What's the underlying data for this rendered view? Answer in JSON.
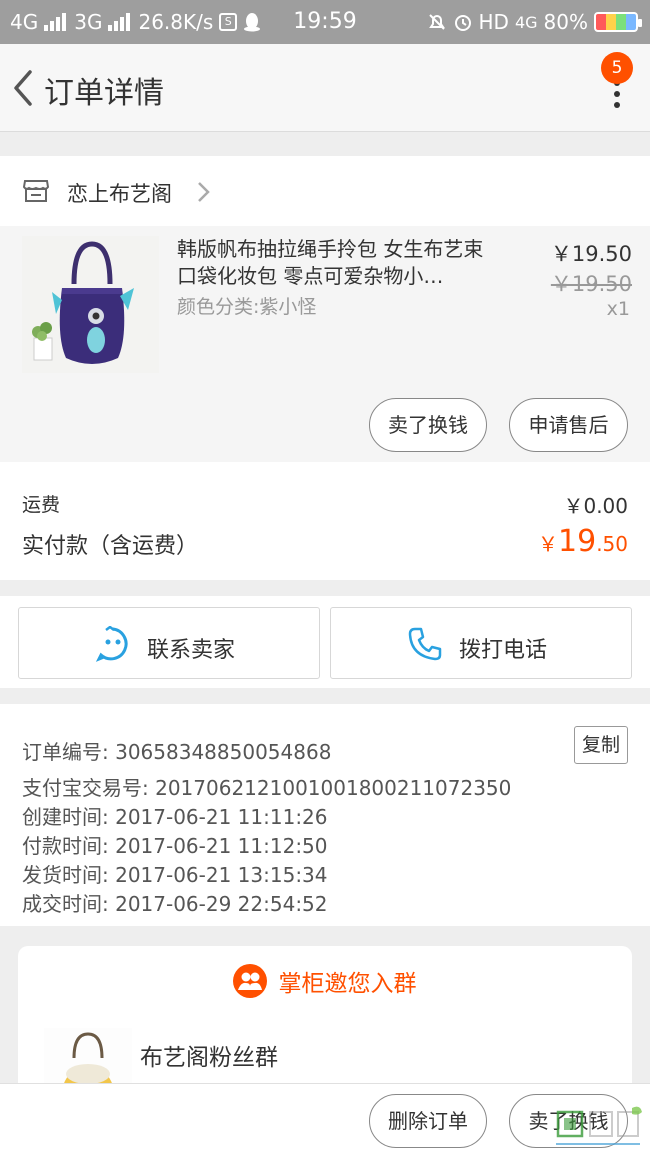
{
  "status_bar": {
    "net1": "4G",
    "net2": "3G",
    "speed": "26.8K/s",
    "sbox": "S",
    "time": "19:59",
    "hd": "HD",
    "net3": "4G",
    "battery": "80%"
  },
  "header": {
    "title": "订单详情",
    "badge_count": "5"
  },
  "shop": {
    "name": "恋上布艺阁"
  },
  "product": {
    "title": "韩版帆布抽拉绳手拎包 女生布艺束口袋化妆包 零点可爱杂物小…",
    "sku": "颜色分类:紫小怪",
    "price": "￥19.50",
    "original_price": "￥19.50",
    "quantity": "x1",
    "exchange_button": "卖了换钱",
    "after_sale_button": "申请售后"
  },
  "totals": {
    "shipping_label": "运费",
    "shipping_value": "￥0.00",
    "paid_label": "实付款（含运费）",
    "paid_currency": "￥",
    "paid_integer": "19",
    "paid_decimal": ".50"
  },
  "contact": {
    "seller_label": "联系卖家",
    "call_label": "拨打电话"
  },
  "order_info": {
    "order_no": "订单编号: 30658348850054868",
    "alipay_no": "支付宝交易号: 2017062121001001800211072350",
    "created": "创建时间: 2017-06-21 11:11:26",
    "paid": "付款时间: 2017-06-21 11:12:50",
    "shipped": "发货时间: 2017-06-21 13:15:34",
    "completed": "成交时间: 2017-06-29 22:54:52",
    "copy_button": "复制"
  },
  "group": {
    "title": "掌柜邀您入群",
    "name": "布艺阁粉丝群"
  },
  "bottom_bar": {
    "delete_button": "删除订单",
    "exchange_button": "卖了换钱"
  },
  "colors": {
    "accent": "#ff5000",
    "icon_blue": "#29a1e0"
  }
}
